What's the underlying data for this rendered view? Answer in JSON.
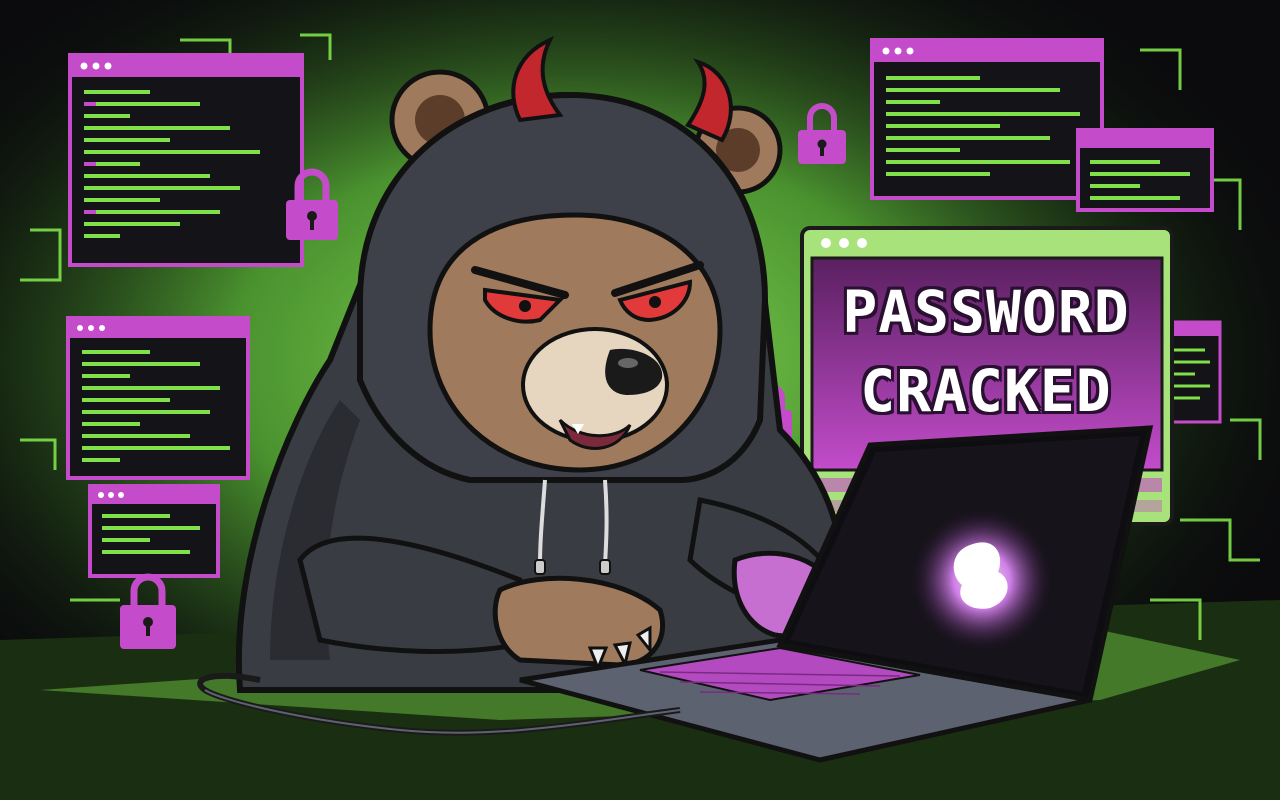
{
  "banner": {
    "line1": "PASSWORD",
    "line2": "CRACKED"
  },
  "icons": [
    "bear-hacker-figure",
    "laptop-icon",
    "padlock-icon",
    "terminal-window-icon",
    "devil-horns-icon"
  ],
  "colors": {
    "background": "#0b0b0d",
    "neon_green": "#7fe04a",
    "neon_magenta": "#c44bc9",
    "hoodie": "#3a3c44",
    "fur": "#a07a5c",
    "eyes": "#e23a3a",
    "horns": "#c2272d"
  }
}
